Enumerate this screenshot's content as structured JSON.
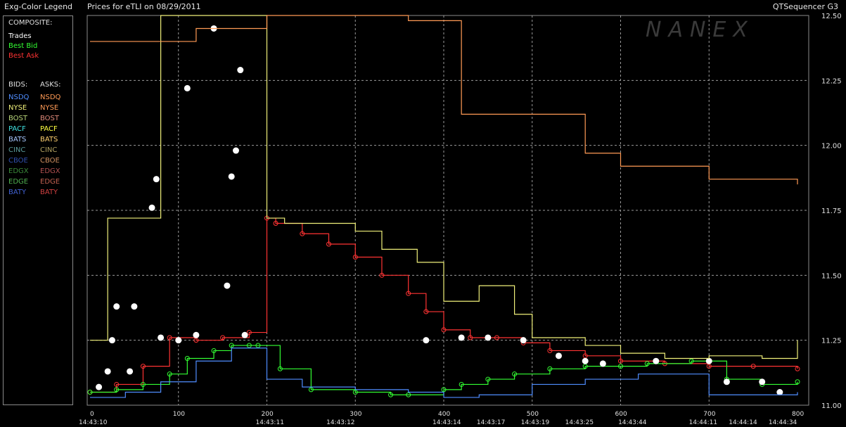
{
  "header": {
    "legend_title": "Exg-Color Legend",
    "chart_title": "Prices for  eTLI  on  08/29/2011",
    "app_name": "QTSequencer G3",
    "watermark": "NANEX"
  },
  "legend": {
    "composite_label": "COMPOSITE:",
    "composite": [
      {
        "label": "Trades",
        "color": "#ffffff"
      },
      {
        "label": "Best Bid",
        "color": "#33ff33"
      },
      {
        "label": "Best Ask",
        "color": "#ff3333"
      }
    ],
    "bids_label": "BIDS:",
    "asks_label": "ASKS:",
    "exchanges": [
      {
        "bid": "NSDQ",
        "bid_color": "#4f8dff",
        "ask": "NSDQ",
        "ask_color": "#ff9a55"
      },
      {
        "bid": "NYSE",
        "bid_color": "#f0f07a",
        "ask": "NYSE",
        "ask_color": "#ff9a55"
      },
      {
        "bid": "BOST",
        "bid_color": "#b9d67a",
        "ask": "BOST",
        "ask_color": "#e08a7a"
      },
      {
        "bid": "PACF",
        "bid_color": "#40e0e0",
        "ask": "PACF",
        "ask_color": "#ffff40"
      },
      {
        "bid": "BATS",
        "bid_color": "#a8c8ff",
        "ask": "BATS",
        "ask_color": "#ffd070"
      },
      {
        "bid": "CINC",
        "bid_color": "#5a9a9a",
        "ask": "CINC",
        "ask_color": "#b0a060"
      },
      {
        "bid": "CBOE",
        "bid_color": "#3050b0",
        "ask": "CBOE",
        "ask_color": "#d09060"
      },
      {
        "bid": "EDGX",
        "bid_color": "#3a8a3a",
        "ask": "EDGX",
        "ask_color": "#b05050"
      },
      {
        "bid": "EDGE",
        "bid_color": "#50b050",
        "ask": "EDGE",
        "ask_color": "#c06050"
      },
      {
        "bid": "BATY",
        "bid_color": "#4060d0",
        "ask": "BATY",
        "ask_color": "#d04040"
      }
    ]
  },
  "chart_data": {
    "type": "line",
    "title": "Prices for  eTLI  on  08/29/2011",
    "x_range": [
      0,
      800
    ],
    "y_range": [
      11.0,
      12.5
    ],
    "grid": true,
    "x_ticks": [
      0,
      100,
      200,
      300,
      400,
      500,
      600,
      700,
      800
    ],
    "y_ticks": [
      "11.00",
      "11.25",
      "11.50",
      "11.75",
      "12.00",
      "12.25",
      "12.50"
    ],
    "time_labels": [
      {
        "x": 0,
        "label": "14:43:10"
      },
      {
        "x": 200,
        "label": "14:43:11"
      },
      {
        "x": 280,
        "label": "14:43:12"
      },
      {
        "x": 400,
        "label": "14:43:14"
      },
      {
        "x": 450,
        "label": "14:43:17"
      },
      {
        "x": 500,
        "label": "14:43:19"
      },
      {
        "x": 550,
        "label": "14:43:25"
      },
      {
        "x": 610,
        "label": "14:43:44"
      },
      {
        "x": 690,
        "label": "14:44:11"
      },
      {
        "x": 735,
        "label": "14:44:14"
      },
      {
        "x": 780,
        "label": "14:44:34"
      }
    ],
    "series": [
      {
        "name": "Best Ask",
        "color": "#ff3333",
        "x": [
          0,
          30,
          60,
          90,
          120,
          150,
          180,
          200,
          210,
          240,
          270,
          300,
          330,
          360,
          380,
          400,
          430,
          460,
          490,
          520,
          560,
          600,
          650,
          700,
          750,
          800
        ],
        "y": [
          11.05,
          11.08,
          11.15,
          11.26,
          11.25,
          11.26,
          11.28,
          11.72,
          11.7,
          11.66,
          11.62,
          11.57,
          11.5,
          11.43,
          11.36,
          11.29,
          11.26,
          11.26,
          11.24,
          11.21,
          11.19,
          11.17,
          11.16,
          11.15,
          11.15,
          11.14
        ]
      },
      {
        "name": "Best Bid",
        "color": "#33ff33",
        "x": [
          0,
          30,
          60,
          90,
          110,
          140,
          160,
          180,
          190,
          215,
          250,
          300,
          340,
          360,
          400,
          420,
          450,
          480,
          520,
          560,
          600,
          630,
          680,
          720,
          760,
          800
        ],
        "y": [
          11.05,
          11.06,
          11.08,
          11.12,
          11.18,
          11.21,
          11.23,
          11.23,
          11.23,
          11.14,
          11.06,
          11.05,
          11.04,
          11.04,
          11.06,
          11.08,
          11.1,
          11.12,
          11.14,
          11.15,
          11.15,
          11.16,
          11.17,
          11.1,
          11.08,
          11.09
        ]
      },
      {
        "name": "Trades",
        "color": "#ffffff",
        "x": [
          10,
          20,
          25,
          30,
          45,
          50,
          70,
          75,
          80,
          100,
          110,
          120,
          140,
          155,
          160,
          165,
          170,
          175,
          380,
          420,
          450,
          490,
          530,
          560,
          580,
          640,
          700,
          720,
          760,
          780
        ],
        "y": [
          11.07,
          11.13,
          11.25,
          11.38,
          11.13,
          11.38,
          11.76,
          11.87,
          11.26,
          11.25,
          12.22,
          11.27,
          12.45,
          11.46,
          11.88,
          11.98,
          12.29,
          11.27,
          11.25,
          11.26,
          11.26,
          11.25,
          11.19,
          11.17,
          11.16,
          11.17,
          11.17,
          11.09,
          11.09,
          11.05
        ]
      },
      {
        "name": "NYSE",
        "color": "#f0f07a",
        "x": [
          0,
          20,
          60,
          80,
          100,
          130,
          140,
          150,
          170,
          200,
          220,
          300,
          330,
          370,
          400,
          440,
          480,
          500,
          560,
          600,
          650,
          700,
          760,
          800
        ],
        "y": [
          11.25,
          11.72,
          11.72,
          12.5,
          12.5,
          12.5,
          12.5,
          12.5,
          12.5,
          11.72,
          11.7,
          11.67,
          11.6,
          11.55,
          11.4,
          11.46,
          11.35,
          11.26,
          11.23,
          11.2,
          11.18,
          11.19,
          11.18,
          11.25
        ]
      },
      {
        "name": "NSDQ",
        "color": "#ff9a55",
        "x": [
          0,
          90,
          120,
          180,
          200,
          300,
          360,
          400,
          420,
          560,
          600,
          700,
          800
        ],
        "y": [
          12.4,
          12.4,
          12.45,
          12.45,
          12.5,
          12.5,
          12.48,
          12.48,
          12.12,
          11.97,
          11.92,
          11.87,
          11.85
        ]
      },
      {
        "name": "NSDQ bid",
        "color": "#4f8dff",
        "x": [
          0,
          40,
          80,
          120,
          160,
          200,
          240,
          300,
          360,
          400,
          440,
          500,
          560,
          620,
          700,
          800
        ],
        "y": [
          11.03,
          11.05,
          11.09,
          11.17,
          11.22,
          11.1,
          11.07,
          11.06,
          11.05,
          11.03,
          11.04,
          11.08,
          11.1,
          11.12,
          11.04,
          11.05
        ]
      }
    ]
  }
}
